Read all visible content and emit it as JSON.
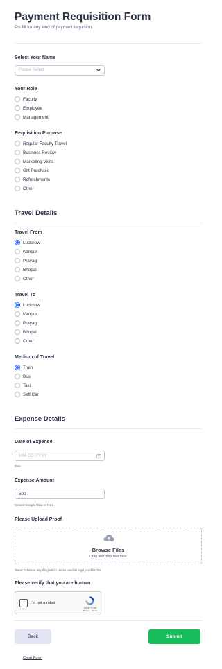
{
  "form": {
    "title": "Payment Requisition Form",
    "subtitle": "Pls fill for any kind of payment requision"
  },
  "select_name": {
    "label": "Select Your Name",
    "placeholder": "Please Select"
  },
  "role": {
    "label": "Your Role",
    "options": [
      "Faculty",
      "Employee",
      "Management"
    ],
    "selected": null
  },
  "purpose": {
    "label": "Requisition Purpose",
    "options": [
      "Regular Faculty Travel",
      "Business Review",
      "Marketing Visits",
      "Gift Purchase",
      "Refreshments",
      "Other"
    ],
    "selected": null
  },
  "travel_details": {
    "title": "Travel Details",
    "from": {
      "label": "Travel From",
      "options": [
        "Lucknow",
        "Kanpur",
        "Prayag",
        "Bhopal",
        "Other"
      ],
      "selected": "Lucknow"
    },
    "to": {
      "label": "Travel To",
      "options": [
        "Lucknow",
        "Kanpur",
        "Prayag",
        "Bhopal",
        "Other"
      ],
      "selected": "Lucknow"
    },
    "medium": {
      "label": "Medium of Travel",
      "options": [
        "Train",
        "Bus",
        "Taxi",
        "Self Car"
      ],
      "selected": "Train"
    }
  },
  "expense_details": {
    "title": "Expense Details",
    "date": {
      "label": "Date of Expense",
      "placeholder": "MM-DD-YYYY",
      "hint": "Date",
      "icon": "calendar-icon"
    },
    "amount": {
      "label": "Expense Amount",
      "value": "500",
      "hint": "Nearest Integral Value of Rs 1."
    },
    "upload": {
      "label": "Please Upload Proof",
      "browse": "Browse Files",
      "drag": "Drag and drop files here",
      "hint": "Travel Tickets or any thing which can be used as legal proof for Tax",
      "icon": "cloud-upload-icon"
    },
    "captcha": {
      "label": "Please verify that you are human",
      "checkbox_text": "I'm not a robot",
      "brand": "reCAPTCHA",
      "links": "Privacy - Terms"
    }
  },
  "actions": {
    "back": "Back",
    "submit": "Submit",
    "clear": "Clear Form"
  },
  "colors": {
    "accent": "#2e69ff",
    "submit": "#18bd5b",
    "back": "#e3e5f5",
    "text": "#2c3345"
  }
}
